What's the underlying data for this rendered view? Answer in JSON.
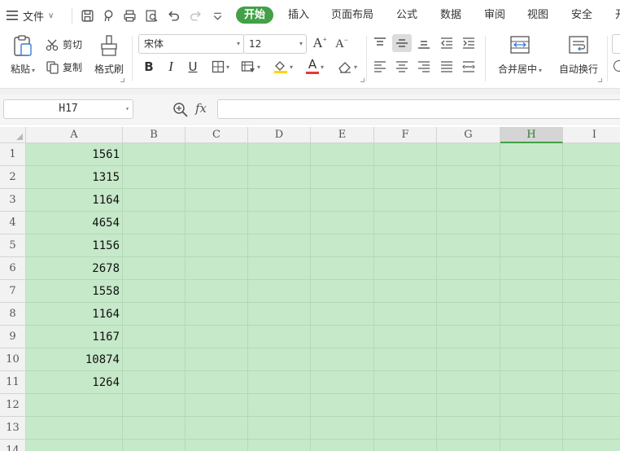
{
  "menubar": {
    "file_label": "文件",
    "tabs": [
      "开始",
      "插入",
      "页面布局",
      "公式",
      "数据",
      "审阅",
      "视图",
      "安全",
      "开"
    ]
  },
  "ribbon": {
    "paste_label": "粘贴",
    "cut_label": "剪切",
    "copy_label": "复制",
    "format_painter_label": "格式刷",
    "font_name": "宋体",
    "font_size": "12",
    "bold_label": "B",
    "italic_label": "I",
    "underline_label": "U",
    "font_color_label": "A",
    "merge_label": "合并居中",
    "wrap_label": "自动换行",
    "colors": {
      "font_color": "#e53935",
      "fill_color": "#ffd600",
      "accent": "#43a047"
    }
  },
  "formula_bar": {
    "name_box": "H17",
    "fx_label": "fx",
    "formula": ""
  },
  "sheet": {
    "columns": [
      "A",
      "B",
      "C",
      "D",
      "E",
      "F",
      "G",
      "H",
      "I"
    ],
    "active_column": "H",
    "rows": [
      "1",
      "2",
      "3",
      "4",
      "5",
      "6",
      "7",
      "8",
      "9",
      "10",
      "11",
      "12",
      "13",
      "14"
    ],
    "column_a_values": [
      "1561",
      "1315",
      "1164",
      "4654",
      "1156",
      "2678",
      "1558",
      "1164",
      "1167",
      "10874",
      "1264"
    ],
    "selection_color": "#c6e9c9"
  }
}
